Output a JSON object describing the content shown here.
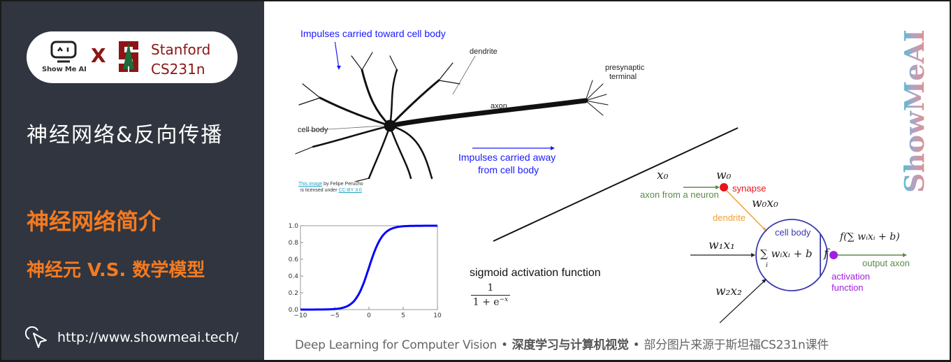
{
  "sidebar": {
    "logo": {
      "showme_label": "Show Me AI",
      "x_mark": "X",
      "stanford_line1": "Stanford",
      "stanford_line2": "CS231n"
    },
    "course_title": "神经网络&反向传播",
    "section_title": "神经网络简介",
    "section_subtitle": "神经元 V.S. 数学模型",
    "url": "http://www.showmeai.tech/",
    "url_icon": "cursor-click-icon"
  },
  "neuron_diagram": {
    "impulses_toward": "Impulses carried toward cell body",
    "dendrite": "dendrite",
    "presynaptic_line1": "presynaptic",
    "presynaptic_line2": "terminal",
    "axon": "axon",
    "cell_body": "cell body",
    "impulses_away_line1": "Impulses carried away",
    "impulses_away_line2": "from cell body",
    "credit_link": "This image",
    "credit_by": " by Felipe Perucho",
    "credit_licensed": "is licensed under ",
    "credit_license": "CC-BY 3.0"
  },
  "math_model": {
    "x0": "x₀",
    "w0": "w₀",
    "synapse": "synapse",
    "axon_from_neuron": "axon from a neuron",
    "w0x0": "w₀x₀",
    "dendrite": "dendrite",
    "cell_body": "cell body",
    "sum_expr": "∑ wᵢxᵢ + b",
    "sum_index": "i",
    "f": "f",
    "w1x1": "w₁x₁",
    "w2x2": "w₂x₂",
    "output_expr": "f(∑ wᵢxᵢ + b)",
    "output_axon": "output axon",
    "activation_line1": "activation",
    "activation_line2": "function",
    "colors": {
      "axon_green": "#5a8a4a",
      "synapse_red": "#e8141b",
      "dendrite_orange": "#f0a030",
      "cell_blue": "#3a3ab0",
      "activation_purple": "#a020e0"
    }
  },
  "sigmoid": {
    "label": "sigmoid activation function",
    "numerator": "1",
    "denominator": "1 + e",
    "exponent": "−x"
  },
  "chart_data": {
    "type": "line",
    "title": "",
    "xlabel": "",
    "ylabel": "",
    "xlim": [
      -10,
      10
    ],
    "ylim": [
      0,
      1
    ],
    "xticks": [
      "−10",
      "−5",
      "0",
      "5",
      "10"
    ],
    "yticks": [
      "0.0",
      "0.2",
      "0.4",
      "0.6",
      "0.8",
      "1.0"
    ],
    "series": [
      {
        "name": "sigmoid",
        "color": "#0000ff",
        "x": [
          -10,
          -8,
          -6,
          -5,
          -4,
          -3,
          -2,
          -1,
          0,
          1,
          2,
          3,
          4,
          5,
          6,
          8,
          10
        ],
        "y": [
          4.54e-05,
          0.000335,
          0.00247,
          0.00669,
          0.018,
          0.0474,
          0.119,
          0.269,
          0.5,
          0.731,
          0.881,
          0.953,
          0.982,
          0.993,
          0.9975,
          0.99966,
          0.99995
        ]
      }
    ],
    "grid": false
  },
  "watermark": "ShowMeAI",
  "footer": {
    "part1": "Deep Learning for Computer Vision",
    "sep": "•",
    "part2": "深度学习与计算机视觉",
    "part3": "部分图片来源于斯坦福CS231n课件"
  }
}
